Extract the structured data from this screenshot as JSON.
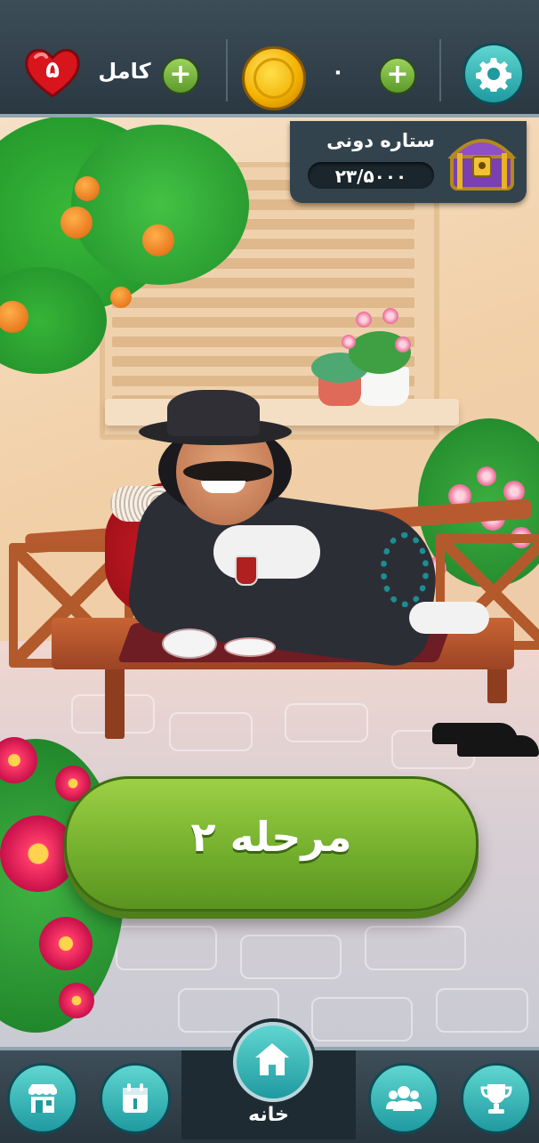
{
  "hud": {
    "lives_count": "۵",
    "lives_status": "کامل",
    "coin_count": "۰",
    "plus_symbol": "+"
  },
  "star_panel": {
    "title": "ستاره دونی",
    "progress": "۲۳/۵۰۰۰"
  },
  "level_button": {
    "label": "مرحله ۲"
  },
  "bottom_nav": {
    "home_label": "خانه",
    "items": [
      {
        "icon": "shop-icon"
      },
      {
        "icon": "calendar-icon"
      },
      {
        "icon": "home-icon"
      },
      {
        "icon": "friends-icon"
      },
      {
        "icon": "trophy-icon"
      }
    ]
  },
  "colors": {
    "accent_green": "#71ad2c",
    "teal_button": "#1f9aa0",
    "heart_red": "#d8141d",
    "coin_gold": "#f4b400"
  }
}
